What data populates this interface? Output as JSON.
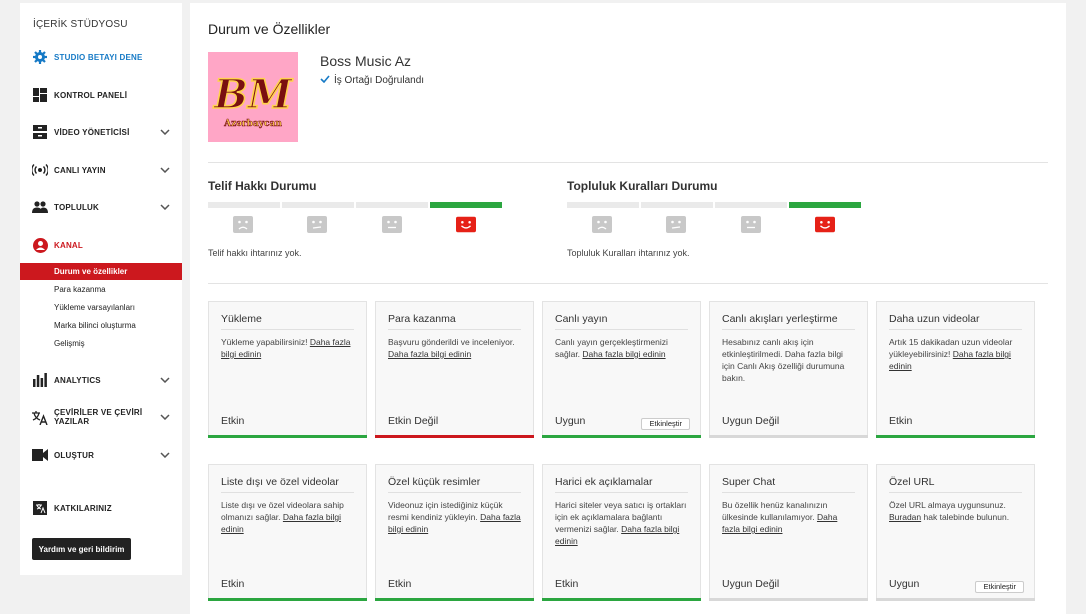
{
  "sidebar": {
    "title": "İÇERİK STÜDYOSU",
    "nav": [
      {
        "label": "STUDIO BETAYI DENE",
        "icon": "gear-icon"
      },
      {
        "label": "KONTROL PANELİ",
        "icon": "dashboard-icon"
      },
      {
        "label": "VİDEO YÖNETİCİSİ",
        "icon": "video-manager-icon"
      },
      {
        "label": "CANLI YAYIN",
        "icon": "live-broadcast-icon"
      },
      {
        "label": "TOPLULUK",
        "icon": "community-icon"
      },
      {
        "label": "KANAL",
        "icon": "account-icon"
      },
      {
        "label": "ANALYTICS",
        "icon": "analytics-icon"
      },
      {
        "label": "ÇEVİRİLER VE ÇEVİRİ",
        "label2": "YAZILAR",
        "icon": "translate-icon"
      },
      {
        "label": "OLUŞTUR",
        "icon": "camera-icon"
      },
      {
        "label": "KATKILARINIZ",
        "icon": "contributions-icon"
      }
    ],
    "channel_sub": [
      "Durum ve özellikler",
      "Para kazanma",
      "Yükleme varsayılanları",
      "Marka bilinci oluşturma",
      "Gelişmiş"
    ],
    "help_button": "Yardım ve geri bildirim",
    "colors": {
      "accent_blue": "#167ac6",
      "accent_red": "#cc181e"
    }
  },
  "main": {
    "title": "Durum ve Özellikler",
    "channel": {
      "name": "Boss Music Az",
      "verified": "İş Ortağı Doğrulandı",
      "logo_text": "BM",
      "logo_sub": "Azərbaycan"
    },
    "copyright": {
      "title": "Telif Hakkı Durumu",
      "text": "Telif hakkı ihtarınız yok."
    },
    "community": {
      "title": "Topluluk Kuralları Durumu",
      "text": "Topluluk Kuralları ihtarınız yok."
    },
    "features": [
      {
        "title": "Yükleme",
        "desc": "Yükleme yapabilirsiniz!",
        "link": "Daha fazla bilgi edinin",
        "status": "Etkin",
        "bar": "#2ba640"
      },
      {
        "title": "Para kazanma",
        "desc": "Başvuru gönderildi ve inceleniyor.",
        "link": "Daha fazla bilgi edinin",
        "status": "Etkin Değil",
        "bar": "#cc181e"
      },
      {
        "title": "Canlı yayın",
        "desc": "Canlı yayın gerçekleştirmenizi sağlar.",
        "link": "Daha fazla bilgi edinin",
        "status": "Uygun",
        "bar": "#2ba640",
        "button": "Etkinleştir"
      },
      {
        "title": "Canlı akışları yerleştirme",
        "desc": "Hesabınız canlı akış için etkinleştirilmedi. Daha fazla bilgi için Canlı Akış özelliği durumuna bakın.",
        "link": "",
        "status": "Uygun Değil",
        "bar": "#d8d8d8"
      },
      {
        "title": "Daha uzun videolar",
        "desc": "Artık 15 dakikadan uzun videolar yükleyebilirsiniz!",
        "link": "Daha fazla bilgi edinin",
        "status": "Etkin",
        "bar": "#2ba640"
      },
      {
        "title": "Liste dışı ve özel videolar",
        "desc": "Liste dışı ve özel videolara sahip olmanızı sağlar.",
        "link": "Daha fazla bilgi edinin",
        "status": "Etkin",
        "bar": "#2ba640"
      },
      {
        "title": "Özel küçük resimler",
        "desc": "Videonuz için istediğiniz küçük resmi kendiniz yükleyin.",
        "link": "Daha fazla bilgi edinin",
        "status": "Etkin",
        "bar": "#2ba640"
      },
      {
        "title": "Harici ek açıklamalar",
        "desc": "Harici siteler veya satıcı iş ortakları için ek açıklamalara bağlantı vermenizi sağlar.",
        "link": "Daha fazla bilgi edinin",
        "status": "Etkin",
        "bar": "#2ba640"
      },
      {
        "title": "Super Chat",
        "desc": "Bu özellik henüz kanalınızın ülkesinde kullanılamıyor.",
        "link": "Daha fazla bilgi edinin",
        "status": "Uygun Değil",
        "bar": "#d8d8d8"
      },
      {
        "title": "Özel URL",
        "desc": "Özel URL almaya uygunsunuz.",
        "link": "Buradan",
        "desc_after": "hak talebinde bulunun.",
        "status": "Uygun",
        "bar": "#d8d8d8",
        "button": "Etkinleştir"
      }
    ]
  }
}
